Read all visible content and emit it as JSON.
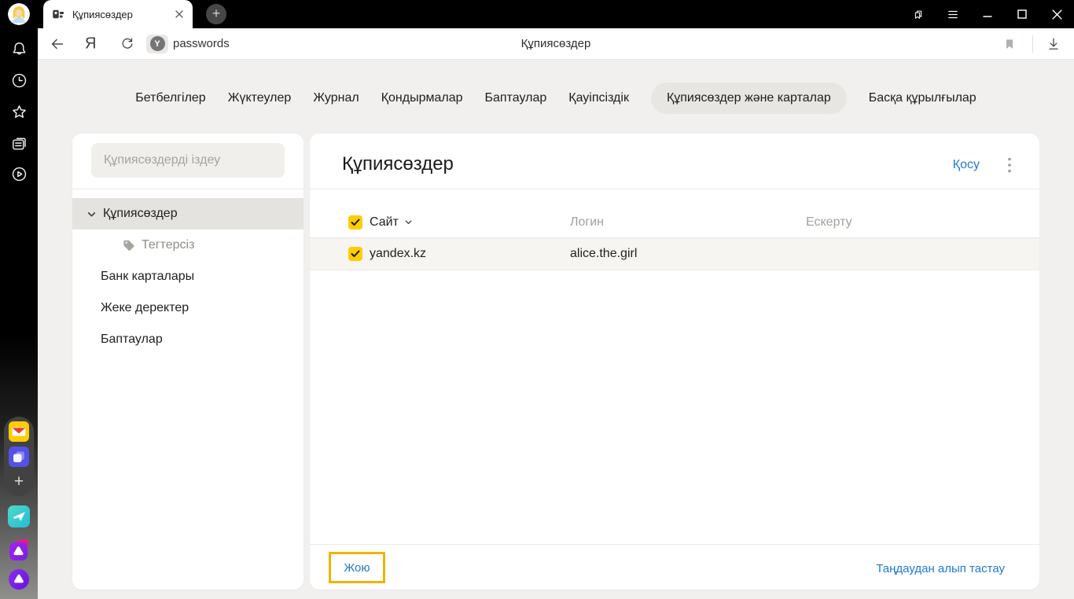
{
  "window": {
    "tab_title": "Құпиясөздер"
  },
  "address_bar": {
    "yandex_logo": "Я",
    "protect_letter": "Y",
    "url_text": "passwords",
    "page_title": "Құпиясөздер"
  },
  "nav": {
    "items": [
      {
        "label": "Бетбелгілер",
        "active": false
      },
      {
        "label": "Жүктеулер",
        "active": false
      },
      {
        "label": "Журнал",
        "active": false
      },
      {
        "label": "Қондырмалар",
        "active": false
      },
      {
        "label": "Баптаулар",
        "active": false
      },
      {
        "label": "Қауіпсіздік",
        "active": false
      },
      {
        "label": "Құпиясөздер және карталар",
        "active": true
      },
      {
        "label": "Басқа құрылғылар",
        "active": false
      }
    ]
  },
  "sidebar": {
    "search_placeholder": "Құпиясөздерді іздеу",
    "items": [
      {
        "label": "Құпиясөздер",
        "selected": true
      },
      {
        "label": "Тегтерсіз",
        "selected": false
      },
      {
        "label": "Банк карталары",
        "selected": false
      },
      {
        "label": "Жеке деректер",
        "selected": false
      },
      {
        "label": "Баптаулар",
        "selected": false
      }
    ]
  },
  "main": {
    "title": "Құпиясөздер",
    "add_label": "Қосу",
    "table": {
      "columns": [
        "Сайт",
        "Логин",
        "Ескерту"
      ],
      "header_checked": true,
      "rows": [
        {
          "site": "yandex.kz",
          "login": "alice.the.girl",
          "note": "",
          "checked": true
        }
      ]
    },
    "footer": {
      "delete_label": "Жою",
      "deselect_label": "Таңдаудан алып тастау"
    }
  },
  "icons": {
    "new_tab_plus": "+",
    "rail_plus": "+"
  },
  "colors": {
    "accent_blue": "#1f7ad2",
    "checkbox_yellow": "#ffcc00",
    "highlight_border": "#f0b400",
    "active_pill_bg": "#e8e6e3",
    "topbar_black": "#000000"
  }
}
